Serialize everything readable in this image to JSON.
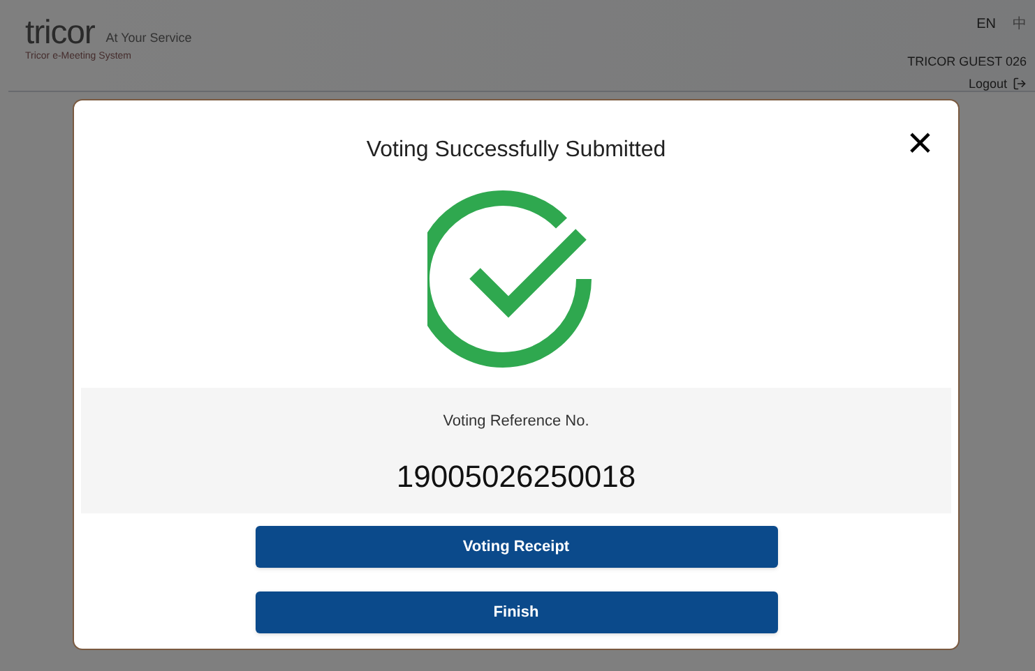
{
  "header": {
    "logo": "tricor",
    "tagline": "At Your Service",
    "system_name": "Tricor e-Meeting System",
    "languages": [
      {
        "label": "EN",
        "selected": true
      },
      {
        "label": "中",
        "selected": false
      }
    ],
    "user": "TRICOR GUEST 026",
    "logout": "Logout"
  },
  "dialog": {
    "title": "Voting Successfully Submitted",
    "close": "×",
    "reference_label": "Voting Reference No.",
    "reference_number": "19005026250018",
    "buttons": [
      "Voting Receipt",
      "Finish"
    ]
  }
}
